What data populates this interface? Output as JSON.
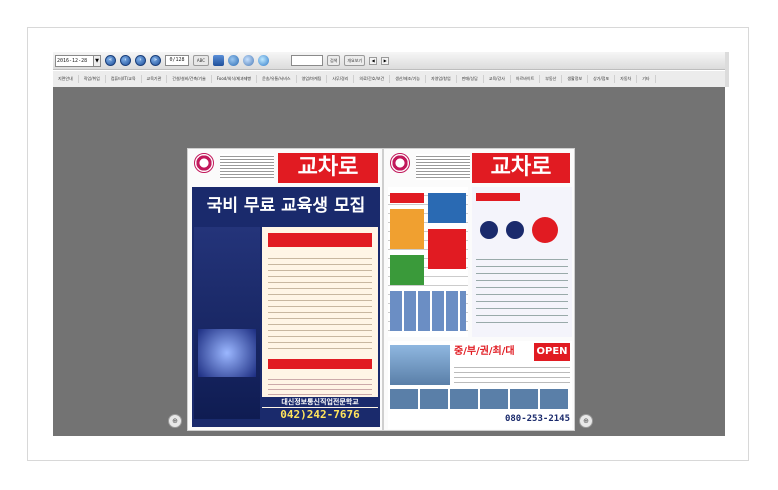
{
  "toolbar": {
    "date_value": "2016-12-28",
    "date_dropdown": "▼",
    "nav_first": "«",
    "nav_prev": "‹",
    "nav_next": "›",
    "nav_last": "»",
    "page_indicator": "0/128",
    "small_label": "ABC",
    "search_button": "검색",
    "search_option": "개요보기",
    "mini_left": "◀",
    "mini_right": "▶"
  },
  "menu": {
    "items": [
      "지면안내",
      "직업/취업",
      "컴퓨터/IT/교육",
      "교육기관",
      "건설/설비/건축/기술",
      "Food/외식/제과제빵",
      "운송/유통/서비스",
      "영업/마케팅",
      "사무/경리",
      "의료/간호/보건",
      "생산/제조/기능",
      "자영업/창업",
      "판매/상담",
      "교육/강사",
      "아르바이트",
      "부동산",
      "생활정보",
      "상가/점포",
      "자동차",
      "기타"
    ]
  },
  "newspaper": {
    "masthead": "교차로",
    "headline": "국비 무료 교육생 모집",
    "phone_left": "042)242-7676",
    "phone_right": "080-253-2145",
    "school_name": "대신정보통신직업전문학교",
    "highlight": "중/부/권/최/대",
    "open_badge": "OPEN"
  },
  "colors": {
    "accent_red": "#e11b22",
    "navy": "#1a2a6c",
    "toolbar_blue": "#1f4f9a",
    "viewer_bg": "#737373"
  }
}
